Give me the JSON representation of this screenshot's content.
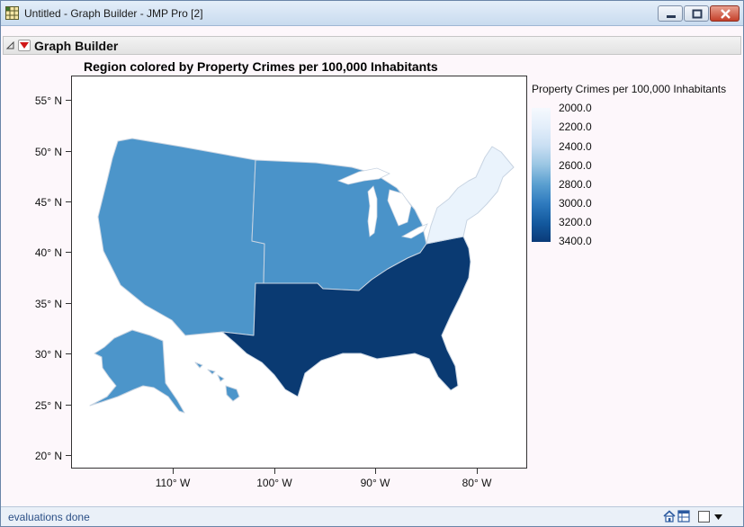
{
  "window": {
    "title": "Untitled - Graph Builder - JMP Pro [2]",
    "icons": {
      "app": "jmp-graph-grid-icon",
      "minimize": "minimize-icon",
      "maximize": "maximize-icon",
      "close": "close-icon"
    }
  },
  "outline": {
    "title": "Graph Builder",
    "icons": {
      "collapse": "disclosure-triangle-icon",
      "menu": "red-triangle-menu-icon"
    }
  },
  "chart_data": {
    "type": "choropleth",
    "title": "Region colored by Property Crimes per 100,000 Inhabitants",
    "x_ticks": [
      "110° W",
      "100° W",
      "90° W",
      "80° W"
    ],
    "y_ticks": [
      "55° N",
      "50° N",
      "45° N",
      "40° N",
      "35° N",
      "30° N",
      "25° N",
      "20° N"
    ],
    "ylim": [
      20,
      55
    ],
    "xlim": [
      -80,
      -110
    ],
    "grid": false,
    "legend": {
      "title": "Property Crimes per 100,000 Inhabitants",
      "placement": "right",
      "ticks": [
        "2000.0",
        "2200.0",
        "2400.0",
        "2600.0",
        "2800.0",
        "3000.0",
        "3200.0",
        "3400.0"
      ]
    },
    "regions": [
      {
        "name": "West",
        "color": "#4c95ca"
      },
      {
        "name": "Midwest",
        "color": "#4a93c9"
      },
      {
        "name": "South",
        "color": "#0a3a72"
      },
      {
        "name": "Northeast",
        "color": "#eaf3fc"
      }
    ]
  },
  "status": {
    "text": "evaluations done",
    "icons": {
      "home": "home-icon",
      "table": "data-table-icon",
      "checkbox": "checkbox-icon",
      "dropdown": "dropdown-arrow-icon"
    }
  }
}
